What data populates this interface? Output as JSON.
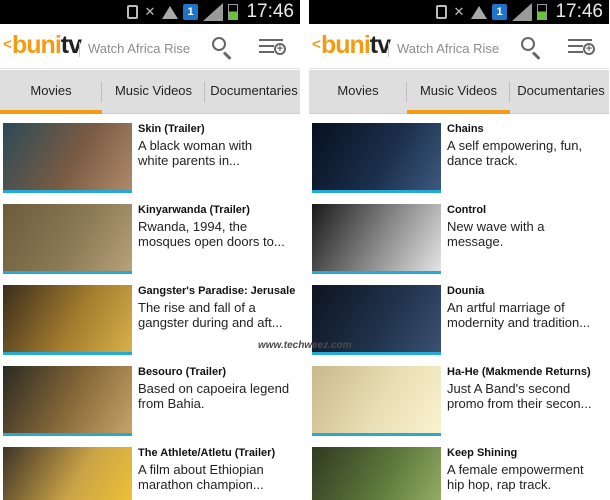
{
  "screens": [
    {
      "status": {
        "time": "17:46",
        "notif_badge": "1"
      },
      "app": {
        "logo_a": "buni",
        "logo_b": "tv",
        "tagline": "Watch Africa Rise"
      },
      "tabs": [
        {
          "label": "Movies",
          "active": true
        },
        {
          "label": "Music Videos",
          "active": false
        },
        {
          "label": "Documentaries",
          "active": false
        }
      ],
      "items": [
        {
          "title": "Skin (Trailer)",
          "desc_line1": "A black woman with",
          "desc_line2": "white parents in...",
          "thumb_colors": [
            "#2c4a57",
            "#7a5b43",
            "#b18a6b"
          ]
        },
        {
          "title": "Kinyarwanda (Trailer)",
          "desc_line1": "Rwanda, 1994, the",
          "desc_line2": "mosques open doors to...",
          "thumb_colors": [
            "#6d5b3a",
            "#8a7a55",
            "#b8a27a"
          ]
        },
        {
          "title": "Gangster's Paradise: Jerusalema (Trailer)",
          "desc_line1": "The rise and fall of a",
          "desc_line2": "gangster during and aft...",
          "thumb_colors": [
            "#3a2d1c",
            "#a47c2e",
            "#d9b24a"
          ]
        },
        {
          "title": "Besouro (Trailer)",
          "desc_line1": "Based on capoeira legend",
          "desc_line2": "from Bahia.",
          "thumb_colors": [
            "#2b2a22",
            "#8b6b3a",
            "#c8a66a"
          ]
        },
        {
          "title": "The Athlete/Atletu (Trailer)",
          "desc_line1": "A film about Ethiopian",
          "desc_line2": "marathon champion...",
          "thumb_colors": [
            "#3e3426",
            "#caa347",
            "#f0c534"
          ]
        }
      ]
    },
    {
      "status": {
        "time": "17:46",
        "notif_badge": "1"
      },
      "app": {
        "logo_a": "buni",
        "logo_b": "tv",
        "tagline": "Watch Africa Rise"
      },
      "tabs": [
        {
          "label": "Movies",
          "active": false
        },
        {
          "label": "Music Videos",
          "active": true
        },
        {
          "label": "Documentaries",
          "active": false
        }
      ],
      "items": [
        {
          "title": "Chains",
          "desc_line1": "A self empowering, fun,",
          "desc_line2": "dance track.",
          "thumb_colors": [
            "#07101f",
            "#1b2e4a",
            "#3c5a80"
          ]
        },
        {
          "title": "Control",
          "desc_line1": "New wave with a",
          "desc_line2": "message.",
          "thumb_colors": [
            "#1a1a1a",
            "#8c8c8c",
            "#e6e6e6"
          ]
        },
        {
          "title": "Dounia",
          "desc_line1": "An artful marriage of",
          "desc_line2": "modernity and tradition...",
          "thumb_colors": [
            "#0d1420",
            "#20324b",
            "#3c5273"
          ]
        },
        {
          "title": "Ha-He (Makmende Returns)",
          "desc_line1": "Just A Band's second",
          "desc_line2": "promo from their secon...",
          "thumb_colors": [
            "#c8b98a",
            "#e9dfb5",
            "#faf3d0"
          ]
        },
        {
          "title": "Keep Shining",
          "desc_line1": "A female empowerment",
          "desc_line2": "hip hop, rap track.",
          "thumb_colors": [
            "#2f3a22",
            "#5f7a3c",
            "#9bb36a"
          ]
        }
      ]
    }
  ],
  "watermark": "www.techweez.com"
}
